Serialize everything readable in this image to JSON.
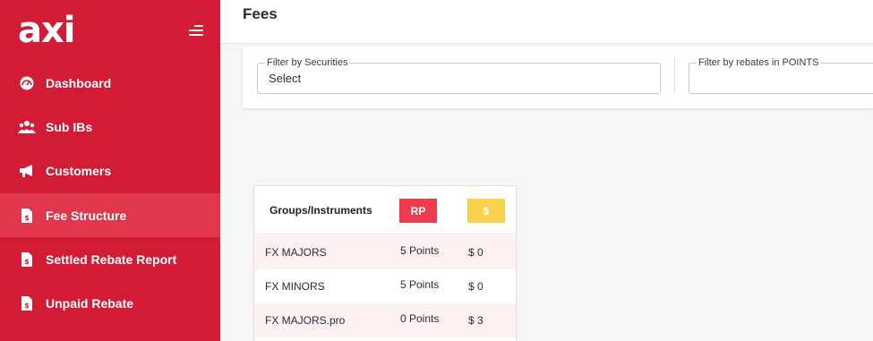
{
  "brand": {
    "logo_text": "axi"
  },
  "sidebar": {
    "items": [
      {
        "label": "Dashboard",
        "icon": "dashboard-icon",
        "active": false
      },
      {
        "label": "Sub IBs",
        "icon": "users-icon",
        "active": false
      },
      {
        "label": "Customers",
        "icon": "megaphone-icon",
        "active": false
      },
      {
        "label": "Fee Structure",
        "icon": "document-dollar-icon",
        "active": true
      },
      {
        "label": "Settled Rebate Report",
        "icon": "document-dollar-icon",
        "active": false
      },
      {
        "label": "Unpaid Rebate",
        "icon": "document-dollar-icon",
        "active": false
      }
    ]
  },
  "header": {
    "title": "Fees"
  },
  "filters": {
    "securities": {
      "label": "Filter by Securities",
      "value": "Select"
    },
    "rebates": {
      "label": "Filter by rebates in POINTS",
      "value": ""
    }
  },
  "table": {
    "header": {
      "groups_label": "Groups/Instruments",
      "rp_label": "RP",
      "usd_label": "$"
    },
    "rows": [
      {
        "instrument": "FX MAJORS",
        "rp": "5 Points",
        "usd": "$ 0"
      },
      {
        "instrument": "FX MINORS",
        "rp": "5 Points",
        "usd": "$ 0"
      },
      {
        "instrument": "FX MAJORS.pro",
        "rp": "0 Points",
        "usd": "$ 3"
      }
    ]
  },
  "colors": {
    "sidebar_bg": "#d21c36",
    "sidebar_active": "#e0374c",
    "rp_badge": "#f03b4e",
    "usd_badge": "#f9d14c",
    "row_tint": "#fdf1f2"
  }
}
